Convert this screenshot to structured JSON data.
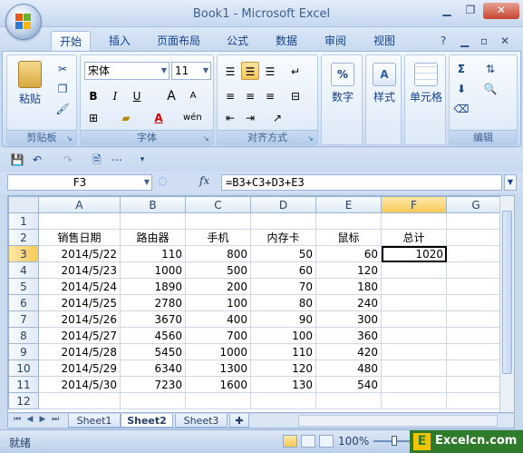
{
  "window": {
    "title": "Book1 - Microsoft Excel"
  },
  "ribbon_tabs": [
    "开始",
    "插入",
    "页面布局",
    "公式",
    "数据",
    "审阅",
    "视图"
  ],
  "ribbon": {
    "clipboard": {
      "paste": "粘贴",
      "label": "剪贴板"
    },
    "font": {
      "name": "宋体",
      "size": "11",
      "label": "字体",
      "bold": "B",
      "italic": "I",
      "underline": "U",
      "grow": "A",
      "shrink": "A",
      "text_color_glyph": "A",
      "phonetic": "wén"
    },
    "alignment": {
      "label": "对齐方式"
    },
    "number": {
      "big_label": "数字",
      "symbol": "%"
    },
    "styles": {
      "big_label": "样式"
    },
    "cells": {
      "big_label": "单元格"
    },
    "editing": {
      "label": "编辑",
      "sum_glyph": "Σ"
    }
  },
  "formula_bar": {
    "name_box": "F3",
    "fx": "fx",
    "formula": "=B3+C3+D3+E3"
  },
  "columns": [
    "A",
    "B",
    "C",
    "D",
    "E",
    "F",
    "G"
  ],
  "rows": [
    {
      "n": "1",
      "cells": [
        "",
        "",
        "",
        "",
        "",
        "",
        ""
      ]
    },
    {
      "n": "2",
      "cells": [
        "销售日期",
        "路由器",
        "手机",
        "内存卡",
        "鼠标",
        "总计",
        ""
      ]
    },
    {
      "n": "3",
      "cells": [
        "2014/5/22",
        "110",
        "800",
        "50",
        "60",
        "1020",
        ""
      ]
    },
    {
      "n": "4",
      "cells": [
        "2014/5/23",
        "1000",
        "500",
        "60",
        "120",
        "",
        ""
      ]
    },
    {
      "n": "5",
      "cells": [
        "2014/5/24",
        "1890",
        "200",
        "70",
        "180",
        "",
        ""
      ]
    },
    {
      "n": "6",
      "cells": [
        "2014/5/25",
        "2780",
        "100",
        "80",
        "240",
        "",
        ""
      ]
    },
    {
      "n": "7",
      "cells": [
        "2014/5/26",
        "3670",
        "400",
        "90",
        "300",
        "",
        ""
      ]
    },
    {
      "n": "8",
      "cells": [
        "2014/5/27",
        "4560",
        "700",
        "100",
        "360",
        "",
        ""
      ]
    },
    {
      "n": "9",
      "cells": [
        "2014/5/28",
        "5450",
        "1000",
        "110",
        "420",
        "",
        ""
      ]
    },
    {
      "n": "10",
      "cells": [
        "2014/5/29",
        "6340",
        "1300",
        "120",
        "480",
        "",
        ""
      ]
    },
    {
      "n": "11",
      "cells": [
        "2014/5/30",
        "7230",
        "1600",
        "130",
        "540",
        "",
        ""
      ]
    },
    {
      "n": "12",
      "cells": [
        "",
        "",
        "",
        "",
        "",
        "",
        ""
      ]
    }
  ],
  "active_cell": {
    "row": "3",
    "col": "F"
  },
  "sheet_tabs": [
    "Sheet1",
    "Sheet2",
    "Sheet3"
  ],
  "active_sheet": "Sheet2",
  "status": {
    "text": "就绪",
    "zoom": "100%"
  },
  "watermark": {
    "text": "Excelcn.com",
    "mark": "E"
  },
  "colors": {
    "accent": "#15428b",
    "selection": "#f8c853",
    "watermark": "#2d7b2b"
  }
}
